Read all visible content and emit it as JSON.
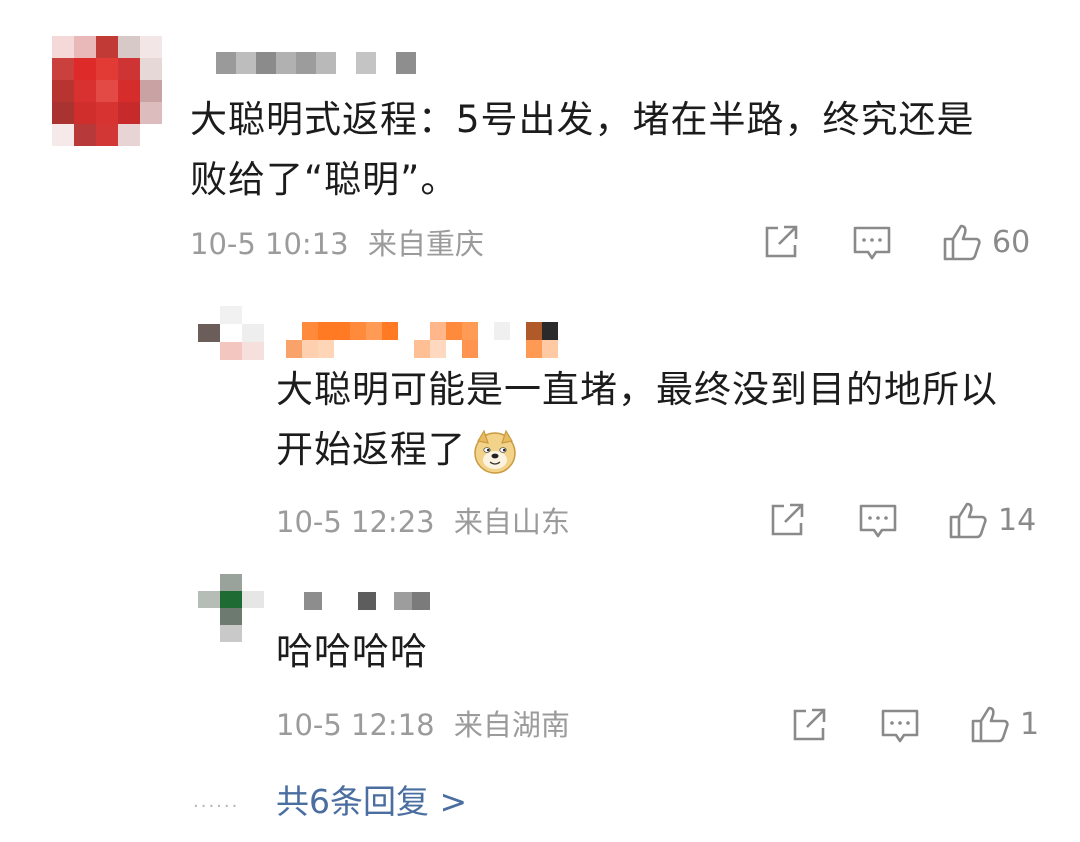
{
  "comments": [
    {
      "text_line1": "大聪明式返程：5号出发，堵在半路，终究还是",
      "text_line2": "败给了“聪明”。",
      "time": "10-5 10:13",
      "location": "来自重庆",
      "likes": "60"
    },
    {
      "text_line1": "大聪明可能是一直堵，最终没到目的地所以",
      "text_line2": "开始返程了",
      "emoji_name": "doge-emoji",
      "time": "10-5 12:23",
      "location": "来自山东",
      "likes": "14"
    },
    {
      "text_line1": "哈哈哈哈",
      "time": "10-5 12:18",
      "location": "来自湖南",
      "likes": "1"
    }
  ],
  "more_replies": {
    "dots": "······",
    "label": "共6条回复 >"
  },
  "colors": {
    "text": "#1c1c1c",
    "meta": "#9b9b9b",
    "link": "#4a6ea0",
    "icon": "#8a8a8a"
  },
  "icons": [
    "share-icon",
    "comment-icon",
    "like-icon"
  ]
}
